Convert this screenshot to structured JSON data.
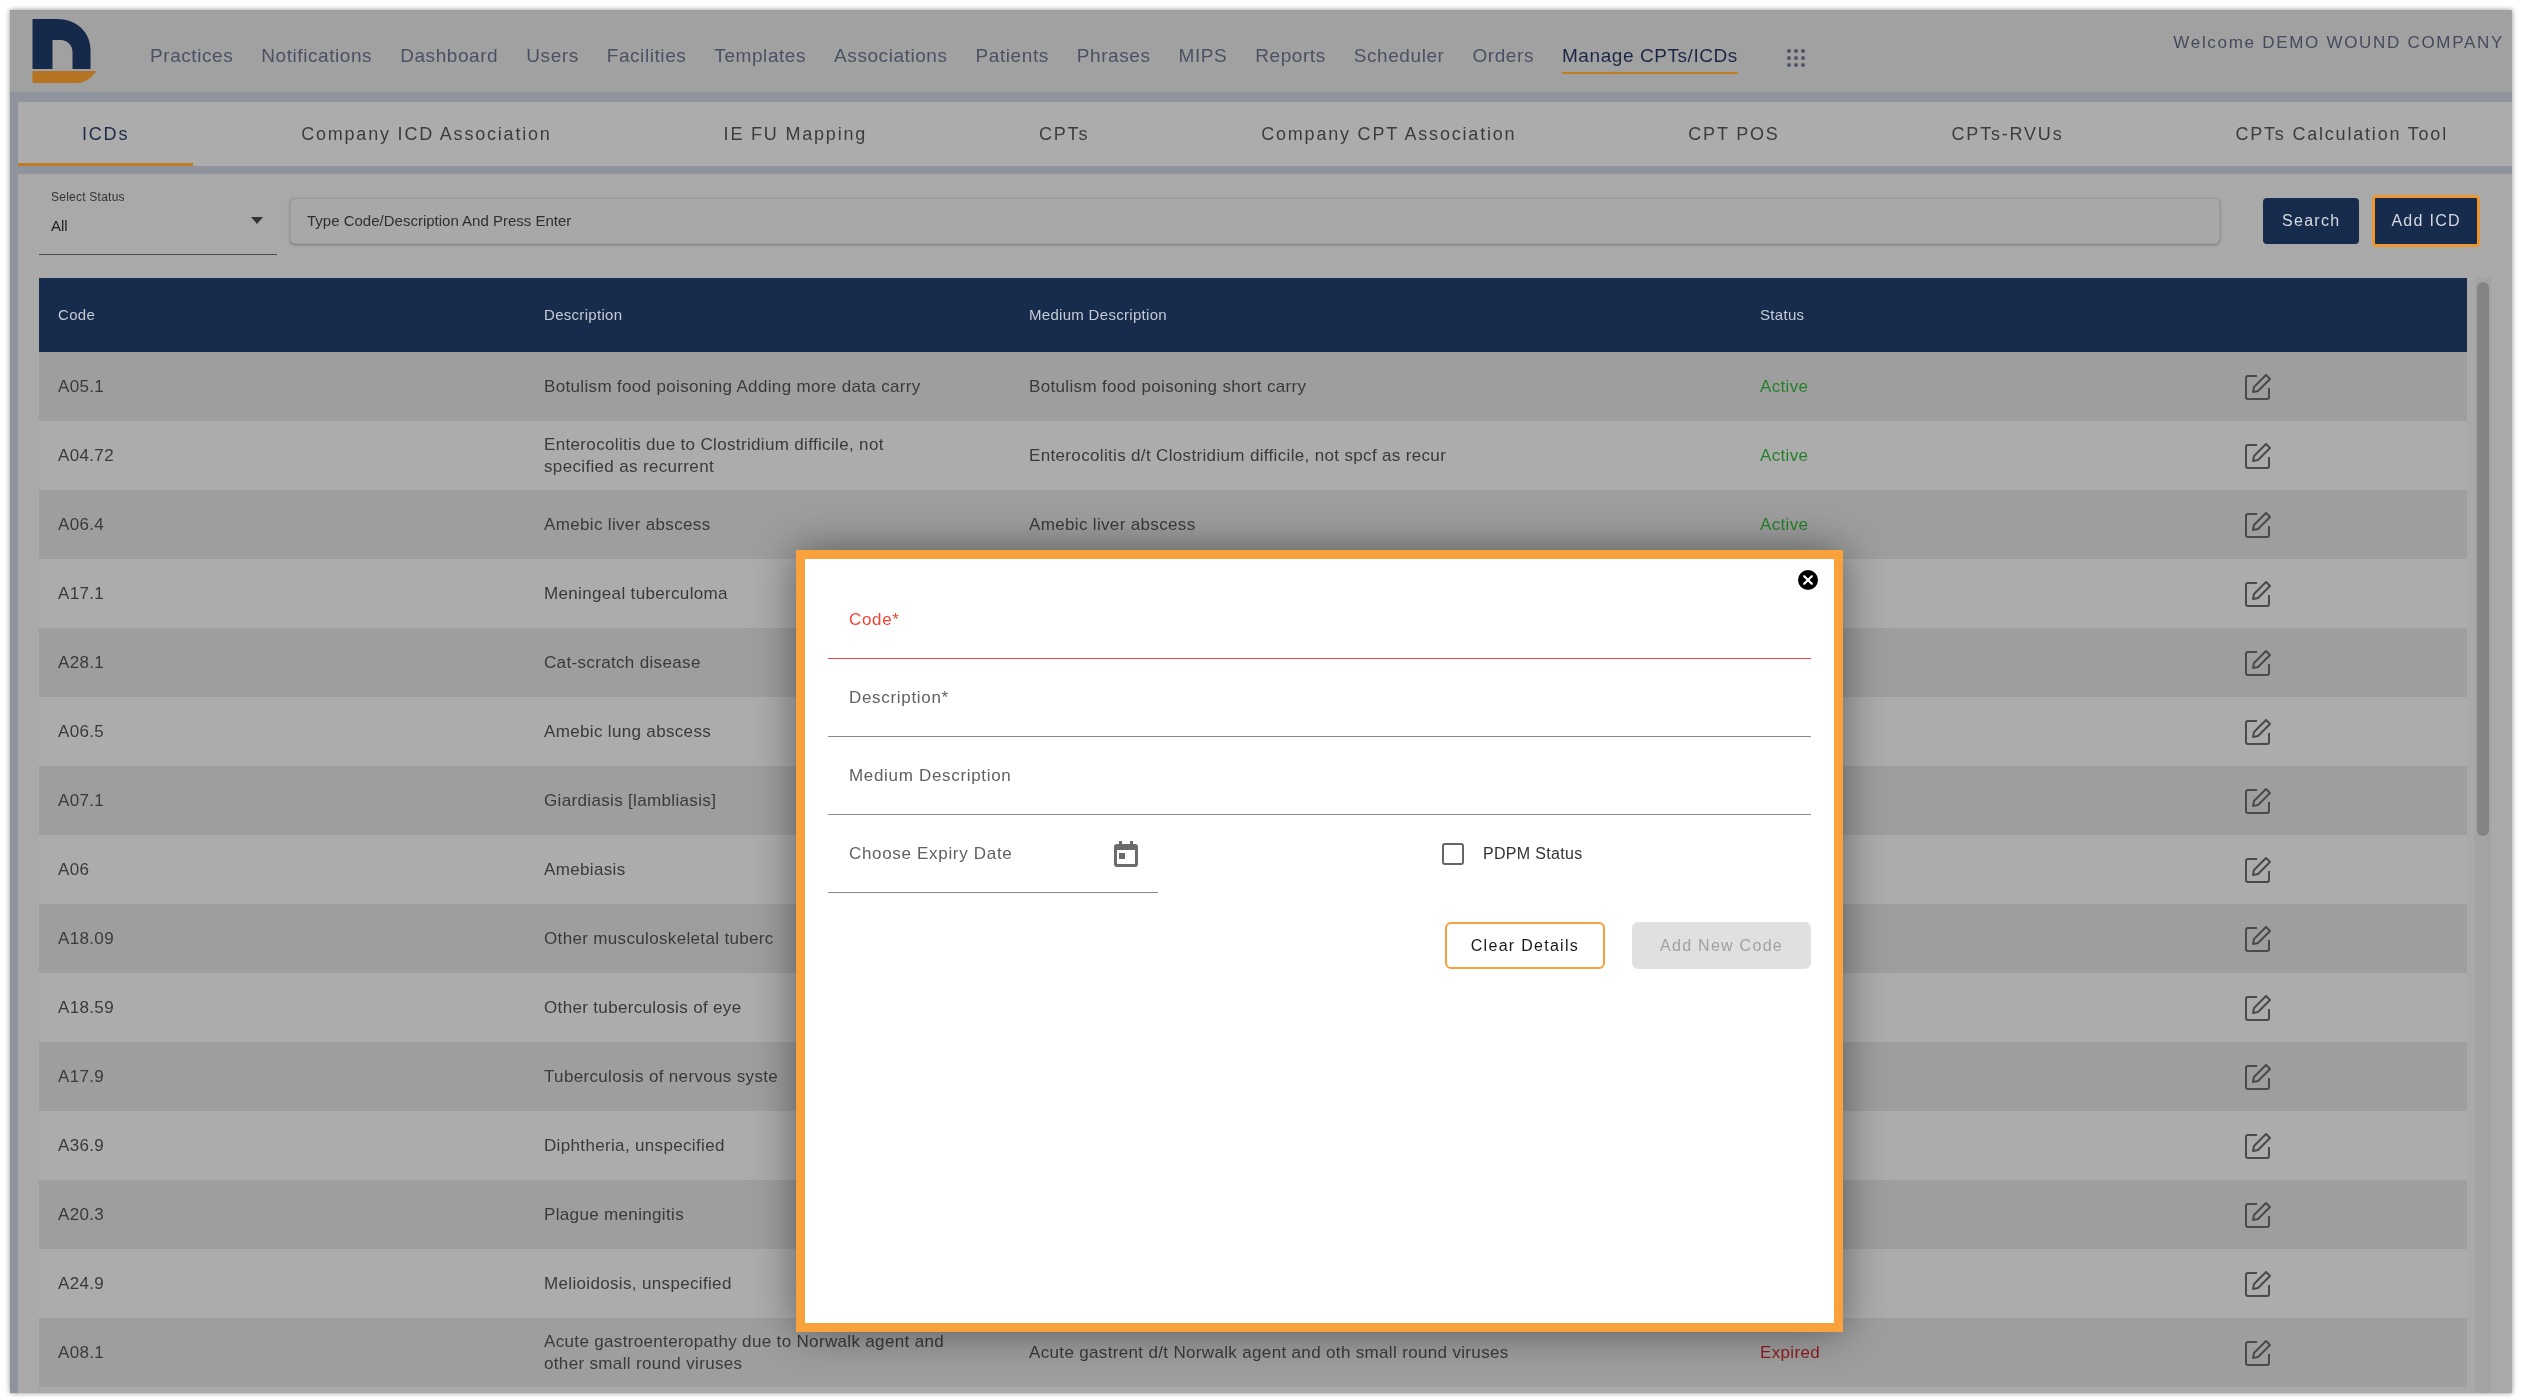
{
  "header": {
    "nav": [
      {
        "label": "Practices",
        "selected": false
      },
      {
        "label": "Notifications",
        "selected": false
      },
      {
        "label": "Dashboard",
        "selected": false
      },
      {
        "label": "Users",
        "selected": false
      },
      {
        "label": "Facilities",
        "selected": false
      },
      {
        "label": "Templates",
        "selected": false
      },
      {
        "label": "Associations",
        "selected": false
      },
      {
        "label": "Patients",
        "selected": false
      },
      {
        "label": "Phrases",
        "selected": false
      },
      {
        "label": "MIPS",
        "selected": false
      },
      {
        "label": "Reports",
        "selected": false
      },
      {
        "label": "Scheduler",
        "selected": false
      },
      {
        "label": "Orders",
        "selected": false
      },
      {
        "label": "Manage CPTs/ICDs",
        "selected": true
      }
    ],
    "welcome": "Welcome DEMO WOUND COMPANY"
  },
  "tabs": [
    {
      "label": "ICDs",
      "selected": true
    },
    {
      "label": "Company ICD Association",
      "selected": false
    },
    {
      "label": "IE FU Mapping",
      "selected": false
    },
    {
      "label": "CPTs",
      "selected": false
    },
    {
      "label": "Company CPT Association",
      "selected": false
    },
    {
      "label": "CPT POS",
      "selected": false
    },
    {
      "label": "CPTs-RVUs",
      "selected": false
    },
    {
      "label": "CPTs Calculation Tool",
      "selected": false
    }
  ],
  "filters": {
    "status_select": {
      "label": "Select Status",
      "value": "All"
    },
    "search_field": {
      "placeholder": "Type Code/Description And Press Enter"
    },
    "buttons": [
      {
        "label": "Search",
        "focused": false
      },
      {
        "label": "Add ICD",
        "focused": true
      }
    ]
  },
  "table": {
    "columns": [
      "Code",
      "Description",
      "Medium Description",
      "Status"
    ],
    "rows": [
      {
        "code": "A05.1",
        "description": "Botulism food poisoning Adding more data carry",
        "medium_description": "Botulism food poisoning short carry",
        "status": {
          "text": "Active",
          "color": "#26802a"
        }
      },
      {
        "code": "A04.72",
        "description": "Enterocolitis due to Clostridium difficile, not specified as recurrent",
        "medium_description": "Enterocolitis d/t Clostridium difficile, not spcf as recur",
        "status": {
          "text": "Active",
          "color": "#26802a"
        }
      },
      {
        "code": "A06.4",
        "description": "Amebic liver abscess",
        "medium_description": "Amebic liver abscess",
        "status": {
          "text": "Active",
          "color": "#26802a"
        }
      },
      {
        "code": "A17.1",
        "description": "Meningeal tuberculoma"
      },
      {
        "code": "A28.1",
        "description": "Cat-scratch disease"
      },
      {
        "code": "A06.5",
        "description": "Amebic lung abscess"
      },
      {
        "code": "A07.1",
        "description": "Giardiasis [lambliasis]"
      },
      {
        "code": "A06",
        "description": "Amebiasis"
      },
      {
        "code": "A18.09",
        "description": "Other musculoskeletal tuberc"
      },
      {
        "code": "A18.59",
        "description": "Other tuberculosis of eye"
      },
      {
        "code": "A17.9",
        "description": "Tuberculosis of nervous syste"
      },
      {
        "code": "A36.9",
        "description": "Diphtheria, unspecified"
      },
      {
        "code": "A20.3",
        "description": "Plague meningitis"
      },
      {
        "code": "A24.9",
        "description": "Melioidosis, unspecified"
      },
      {
        "code": "A08.1",
        "description": "Acute gastroenteropathy due to Norwalk agent and other small round viruses",
        "medium_description": "Acute gastrent d/t Norwalk agent and oth small round viruses",
        "status": {
          "text": "Expired",
          "color": "#8e1b1b"
        }
      }
    ]
  },
  "dialog": {
    "fields": [
      {
        "kind": "text",
        "label": "Code*",
        "error": true
      },
      {
        "kind": "text",
        "label": "Description*",
        "error": false
      },
      {
        "kind": "text",
        "label": "Medium Description",
        "error": false
      },
      {
        "kind": "date",
        "label": "Choose Expiry Date",
        "error": false
      }
    ],
    "checkbox": {
      "label": "PDPM Status",
      "checked": false
    },
    "buttons": [
      {
        "label": "Clear Details",
        "disabled": false
      },
      {
        "label": "Add New Code",
        "disabled": true
      }
    ]
  }
}
